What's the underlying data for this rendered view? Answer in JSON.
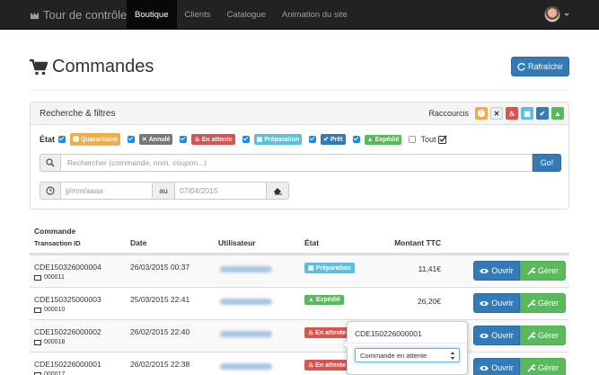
{
  "navbar": {
    "brand": "Tour de contrôle",
    "items": [
      {
        "label": "Boutique",
        "active": true
      },
      {
        "label": "Clients",
        "active": false
      },
      {
        "label": "Catalogue",
        "active": false
      },
      {
        "label": "Animation du site",
        "active": false
      }
    ]
  },
  "header": {
    "title": "Commandes",
    "refresh_label": "Rafraîchir"
  },
  "filters": {
    "title": "Recherche & filtres",
    "shortcuts_label": "Raccourcis",
    "shortcuts": [
      {
        "name": "quarantine",
        "color": "#f0ad4e",
        "glyph": "!"
      },
      {
        "name": "cancelled",
        "color": "#eeeeee",
        "glyph": "✕"
      },
      {
        "name": "pending",
        "color": "#d9534f",
        "glyph": "⚑"
      },
      {
        "name": "preparing",
        "color": "#5bc0de",
        "glyph": "▣"
      },
      {
        "name": "ready",
        "color": "#337ab7",
        "glyph": "✔"
      },
      {
        "name": "shipped",
        "color": "#5cb85c",
        "glyph": "▲"
      }
    ],
    "state_label": "État",
    "states": [
      {
        "label": "Quarantaine",
        "color": "#f0ad4e",
        "checked": true
      },
      {
        "label": "Annulé",
        "color": "#777777",
        "checked": true
      },
      {
        "label": "En attente",
        "color": "#d9534f",
        "checked": true
      },
      {
        "label": "Préparation",
        "color": "#5bc0de",
        "checked": true
      },
      {
        "label": "Prêt",
        "color": "#337ab7",
        "checked": true
      },
      {
        "label": "Expédié",
        "color": "#5cb85c",
        "checked": true
      }
    ],
    "all_label": "Tout",
    "search_placeholder": "Rechercher (commande, nom, coupon...)",
    "search_button": "Go!",
    "date_from_placeholder": "jj/mm/aaaa",
    "date_between": "au",
    "date_to_value": "07/04/2015"
  },
  "table": {
    "headers": {
      "order": "Commande",
      "transaction": "Transaction ID",
      "date": "Date",
      "user": "Utilisateur",
      "state": "État",
      "amount": "Montant TTC"
    },
    "open_label": "Ouvrir",
    "manage_label": "Gérer",
    "rows": [
      {
        "order": "CDE150326000004",
        "tx": "000011",
        "date": "26/03/2015 00:37",
        "state": "Préparation",
        "state_color": "#5bc0de",
        "amount": "11,41€"
      },
      {
        "order": "CDE150325000003",
        "tx": "000010",
        "date": "25/03/2015 22:41",
        "state": "Expédié",
        "state_color": "#5cb85c",
        "amount": "26,20€"
      },
      {
        "order": "CDE150226000002",
        "tx": "000018",
        "date": "26/02/2015 22:40",
        "state": "En attente",
        "state_color": "#d9534f",
        "amount": ""
      },
      {
        "order": "CDE150226000001",
        "tx": "000017",
        "date": "26/02/2015 22:38",
        "state": "En attente",
        "state_color": "#d9534f",
        "amount": ""
      }
    ]
  },
  "popover": {
    "title": "CDE150226000001",
    "select_value": "Commande en attente"
  }
}
